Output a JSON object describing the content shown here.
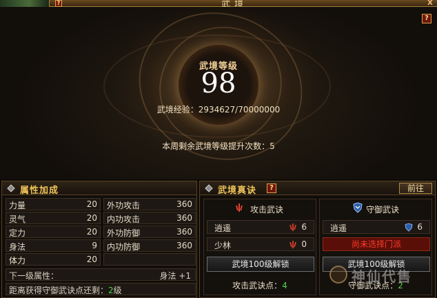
{
  "window": {
    "title": "武境",
    "help": "?",
    "close": "X"
  },
  "hero": {
    "help": "?",
    "level_label": "武境等级",
    "level": "98",
    "exp_text": "武境经验：2934627/70000000",
    "weekly_text": "本周剩余武境等级提升次数：5"
  },
  "attributes": {
    "title": "属性加成",
    "rows": [
      {
        "l_label": "力量",
        "l_value": "20",
        "r_label": "外功攻击",
        "r_value": "360"
      },
      {
        "l_label": "灵气",
        "l_value": "20",
        "r_label": "内功攻击",
        "r_value": "360"
      },
      {
        "l_label": "定力",
        "l_value": "20",
        "r_label": "外功防御",
        "r_value": "360"
      },
      {
        "l_label": "身法",
        "l_value": "9",
        "r_label": "内功防御",
        "r_value": "360"
      },
      {
        "l_label": "体力",
        "l_value": "20",
        "r_label": "",
        "r_value": ""
      }
    ],
    "next_label": "下一级属性：",
    "next_value": "身法 +1",
    "dist_label": "距离获得守御武诀点还剩：",
    "dist_value": "2",
    "dist_unit": "级"
  },
  "secrets": {
    "title": "武境真诀",
    "help": "?",
    "goto_button": "前往",
    "attack": {
      "title": "攻击武诀",
      "schools": [
        {
          "name": "逍遥",
          "count": "6"
        },
        {
          "name": "少林",
          "count": "0"
        }
      ],
      "unlock_button": "武境100级解锁",
      "points_label": "攻击武诀点：",
      "points_value": "4"
    },
    "defense": {
      "title": "守御武诀",
      "schools": [
        {
          "name": "逍遥",
          "count": "6"
        }
      ],
      "unset_text": "尚未选择门派",
      "unlock_button": "武境100级解锁",
      "points_label": "守御武诀点：",
      "points_value": "2"
    }
  },
  "watermark": {
    "text": "神仙代售"
  },
  "colors": {
    "gold": "#f0c45a",
    "green": "#4fd64f",
    "red": "#ff3b2a"
  }
}
